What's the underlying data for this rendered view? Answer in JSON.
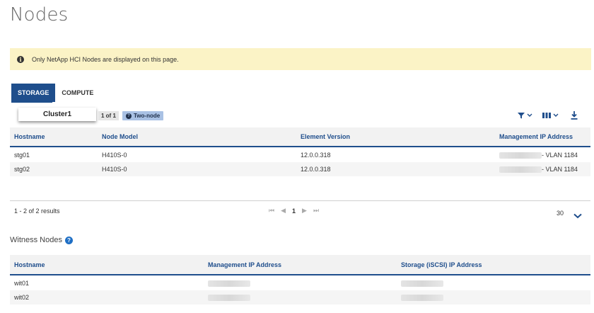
{
  "page": {
    "title": "Nodes"
  },
  "banner": {
    "icon": "info-icon",
    "text": "Only NetApp HCI Nodes are displayed on this page."
  },
  "tabs": [
    {
      "label": "STORAGE",
      "active": true
    },
    {
      "label": "COMPUTE",
      "active": false
    }
  ],
  "cluster": {
    "name": "Cluster1",
    "count": "1 of 1",
    "badge": "Two-node"
  },
  "toolbar": {
    "icons": [
      "filter-icon",
      "columns-icon",
      "download-icon"
    ],
    "accent": "#1f4e8c"
  },
  "storage_table": {
    "headers": [
      "Hostname",
      "Node Model",
      "Element Version",
      "Management IP Address"
    ],
    "rows": [
      {
        "hostname": "stg01",
        "model": "H410S-0",
        "version": "12.0.0.318",
        "vlan": "- VLAN 1184"
      },
      {
        "hostname": "stg02",
        "model": "H410S-0",
        "version": "12.0.0.318",
        "vlan": "- VLAN 1184"
      }
    ]
  },
  "pagination": {
    "results": "1 - 2 of 2 results",
    "current_page": "1",
    "page_size": "30"
  },
  "witness": {
    "title": "Witness Nodes",
    "headers": [
      "Hostname",
      "Management IP Address",
      "Storage (iSCSI) IP Address"
    ],
    "rows": [
      {
        "hostname": "wit01"
      },
      {
        "hostname": "wit02"
      }
    ]
  },
  "colors": {
    "primary": "#1f4e8c",
    "banner_bg": "#fbf3c6",
    "badge_bg": "#a9c1e4"
  }
}
